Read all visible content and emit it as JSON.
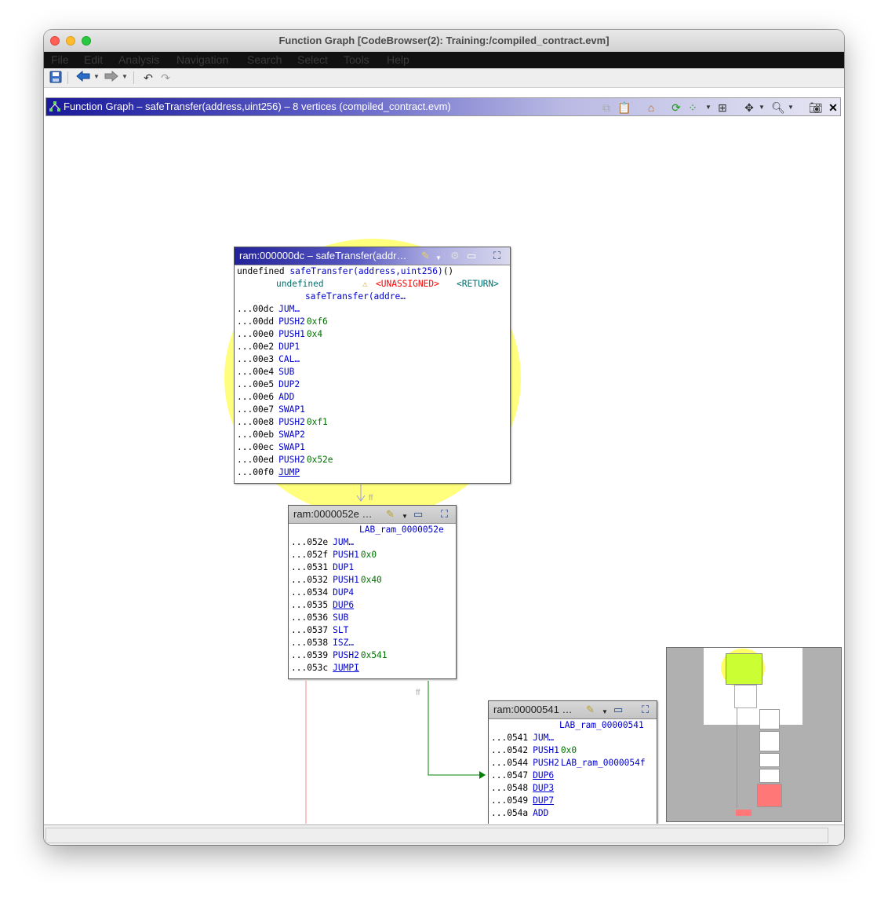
{
  "window": {
    "title": "Function Graph [CodeBrowser(2): Training:/compiled_contract.evm]"
  },
  "menu": [
    "File",
    "Edit",
    "Analysis",
    "Navigation",
    "Search",
    "Select",
    "Tools",
    "Help"
  ],
  "toolbar": {
    "icons": [
      "save-icon",
      "back-arrow-icon",
      "forward-arrow-icon",
      "undo-icon",
      "redo-icon"
    ]
  },
  "graph_header": {
    "title": "Function Graph – safeTransfer(address,uint256) – 8 vertices  (compiled_contract.evm)",
    "icons": [
      "copy-icon",
      "paste-icon",
      "home-icon",
      "refresh-icon",
      "layout-icon",
      "grid-icon",
      "navigate-icon",
      "zoom-icon",
      "snapshot-icon",
      "close-icon"
    ]
  },
  "vertex1": {
    "title": "ram:000000dc – safeTransfer(addr…",
    "signature_prefix": "undefined ",
    "signature_name": "safeTransfer(address,uint256)",
    "signature_suffix": "()",
    "ret_type": "undefined",
    "unassigned": "<UNASSIGNED>",
    "ret_label": "<RETURN>",
    "func_label": "safeTransfer(addre…",
    "lines": [
      {
        "addr": "...00dc",
        "mnemonic": "JUM…",
        "operand": ""
      },
      {
        "addr": "...00dd",
        "mnemonic": "PUSH2",
        "operand": "0xf6"
      },
      {
        "addr": "...00e0",
        "mnemonic": "PUSH1",
        "operand": "0x4"
      },
      {
        "addr": "...00e2",
        "mnemonic": "DUP1",
        "operand": ""
      },
      {
        "addr": "...00e3",
        "mnemonic": "CAL…",
        "operand": ""
      },
      {
        "addr": "...00e4",
        "mnemonic": "SUB",
        "operand": ""
      },
      {
        "addr": "...00e5",
        "mnemonic": "DUP2",
        "operand": ""
      },
      {
        "addr": "...00e6",
        "mnemonic": "ADD",
        "operand": ""
      },
      {
        "addr": "...00e7",
        "mnemonic": "SWAP1",
        "operand": ""
      },
      {
        "addr": "...00e8",
        "mnemonic": "PUSH2",
        "operand": "0xf1"
      },
      {
        "addr": "...00eb",
        "mnemonic": "SWAP2",
        "operand": ""
      },
      {
        "addr": "...00ec",
        "mnemonic": "SWAP1",
        "operand": ""
      },
      {
        "addr": "...00ed",
        "mnemonic": "PUSH2",
        "operand": "0x52e"
      },
      {
        "addr": "...00f0",
        "mnemonic": "JUMP",
        "operand": ""
      }
    ]
  },
  "vertex2": {
    "title": "ram:0000052e …",
    "label": "LAB_ram_0000052e",
    "lines": [
      {
        "addr": "...052e",
        "mnemonic": "JUM…",
        "operand": ""
      },
      {
        "addr": "...052f",
        "mnemonic": "PUSH1",
        "operand": "0x0"
      },
      {
        "addr": "...0531",
        "mnemonic": "DUP1",
        "operand": ""
      },
      {
        "addr": "...0532",
        "mnemonic": "PUSH1",
        "operand": "0x40"
      },
      {
        "addr": "...0534",
        "mnemonic": "DUP4",
        "operand": ""
      },
      {
        "addr": "...0535",
        "mnemonic": "DUP6",
        "operand": ""
      },
      {
        "addr": "...0536",
        "mnemonic": "SUB",
        "operand": ""
      },
      {
        "addr": "...0537",
        "mnemonic": "SLT",
        "operand": ""
      },
      {
        "addr": "...0538",
        "mnemonic": "ISZ…",
        "operand": ""
      },
      {
        "addr": "...0539",
        "mnemonic": "PUSH2",
        "operand": "0x541"
      },
      {
        "addr": "...053c",
        "mnemonic": "JUMPI",
        "operand": ""
      }
    ]
  },
  "vertex3": {
    "title": "ram:00000541 …",
    "label": "LAB_ram_00000541",
    "lines": [
      {
        "addr": "...0541",
        "mnemonic": "JUM…",
        "operand": ""
      },
      {
        "addr": "...0542",
        "mnemonic": "PUSH1",
        "operand": "0x0"
      },
      {
        "addr": "...0544",
        "mnemonic": "PUSH2",
        "operand": "LAB_ram_0000054f"
      },
      {
        "addr": "...0547",
        "mnemonic": "DUP6",
        "operand": ""
      },
      {
        "addr": "...0548",
        "mnemonic": "DUP3",
        "operand": ""
      },
      {
        "addr": "...0549",
        "mnemonic": "DUP7",
        "operand": ""
      },
      {
        "addr": "...054a",
        "mnemonic": "ADD",
        "operand": ""
      }
    ]
  },
  "edges": {
    "fallthrough_label": "ff",
    "jump_label": "ff"
  },
  "colors": {
    "highlight": "#ffff66",
    "jump_edge": "#008000",
    "fall_edge": "#9999ee",
    "back_edge": "#ee8888",
    "satellite_current": "#ccff33",
    "satellite_terminal": "#ff7777"
  }
}
